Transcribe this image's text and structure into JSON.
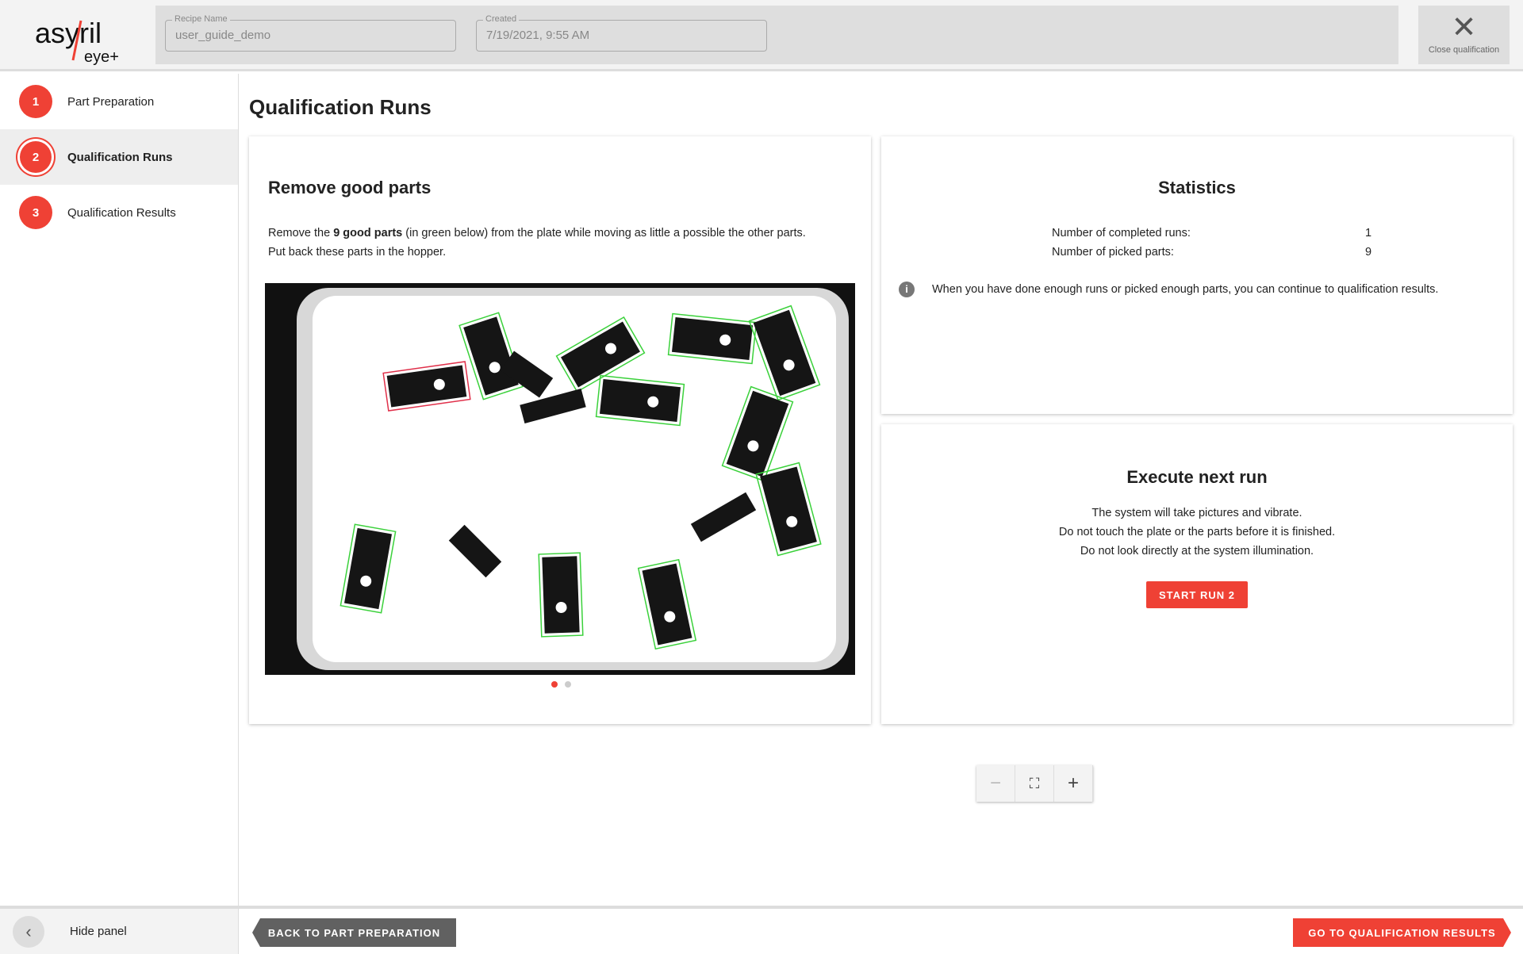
{
  "header": {
    "logo_text": "asyril",
    "logo_sub": "eye+",
    "recipe_label": "Recipe Name",
    "recipe_value": "user_guide_demo",
    "created_label": "Created",
    "created_value": "7/19/2021, 9:55 AM",
    "close_label": "Close qualification"
  },
  "sidebar": {
    "steps": [
      {
        "num": "1",
        "label": "Part Preparation"
      },
      {
        "num": "2",
        "label": "Qualification Runs"
      },
      {
        "num": "3",
        "label": "Qualification Results"
      }
    ],
    "hide_label": "Hide panel"
  },
  "page_title": "Qualification Runs",
  "remove": {
    "title": "Remove good parts",
    "text_pre": "Remove the ",
    "text_bold": "9 good parts",
    "text_post": " (in green below) from the plate while moving as little a possible the other parts.",
    "text_line2": "Put back these parts in the hopper.",
    "carousel_pages": 2,
    "carousel_active": 1
  },
  "statistics": {
    "title": "Statistics",
    "rows": [
      {
        "label": "Number of completed runs:",
        "value": "1"
      },
      {
        "label": "Number of picked parts:",
        "value": "9"
      }
    ],
    "info": "When you have done enough runs or picked enough parts, you can continue to qualification results."
  },
  "execute": {
    "title": "Execute next run",
    "lines": [
      "The system will take pictures and vibrate.",
      "Do not touch the plate or the parts before it is finished.",
      "Do not look directly at the system illumination."
    ],
    "button": "START RUN 2"
  },
  "footer": {
    "back": "BACK TO PART PREPARATION",
    "next": "GO TO QUALIFICATION RESULTS"
  },
  "colors": {
    "accent": "#ef4135",
    "good": "#3bd13b",
    "bad": "#e0304a",
    "back_button": "#616161"
  }
}
